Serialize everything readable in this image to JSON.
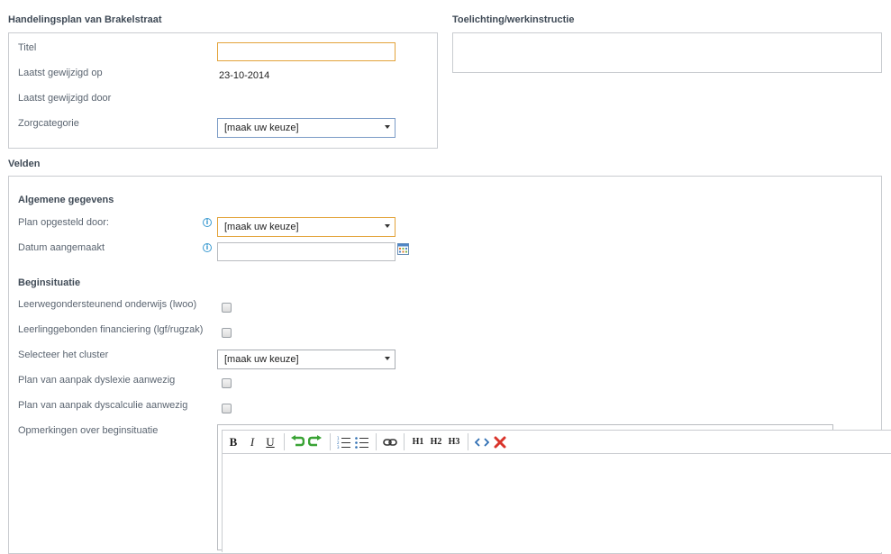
{
  "plan": {
    "title": "Handelingsplan van Brakelstraat",
    "fields": {
      "titel_label": "Titel",
      "titel_value": "",
      "gewijzigd_op_label": "Laatst gewijzigd op",
      "gewijzigd_op_value": "23-10-2014",
      "gewijzigd_door_label": "Laatst gewijzigd door",
      "gewijzigd_door_value": "",
      "zorgcategorie_label": "Zorgcategorie",
      "zorgcategorie_value": "[maak uw keuze]"
    }
  },
  "toelichting": {
    "title": "Toelichting/werkinstructie"
  },
  "velden": {
    "title": "Velden",
    "algemene": {
      "heading": "Algemene gegevens",
      "opgesteld_label": "Plan opgesteld door:",
      "opgesteld_value": "[maak uw keuze]",
      "datum_label": "Datum aangemaakt",
      "datum_value": ""
    },
    "begin": {
      "heading": "Beginsituatie",
      "lwoo_label": "Leerwegondersteunend onderwijs (lwoo)",
      "lgf_label": "Leerlinggebonden financiering (lgf/rugzak)",
      "cluster_label": "Selecteer het cluster",
      "cluster_value": "[maak uw keuze]",
      "dyslexie_label": "Plan van aanpak dyslexie aanwezig",
      "dyscalculie_label": "Plan van aanpak dyscalculie aanwezig",
      "opmerkingen_label": "Opmerkingen over beginsituatie"
    }
  },
  "editor_toolbar": {
    "bold": "B",
    "italic": "I",
    "underline": "U",
    "h1": "H1",
    "h2": "H2",
    "h3": "H3"
  },
  "colors": {
    "focus_orange": "#e3a33a",
    "select_blue": "#7b9bc6",
    "info_blue": "#3a9ad1",
    "undo_green": "#3aa335",
    "remove_red": "#d9342b"
  },
  "icons": [
    "info-icon",
    "calendar-icon",
    "undo-icon",
    "redo-icon",
    "ordered-list-icon",
    "unordered-list-icon",
    "link-icon",
    "source-code-icon",
    "remove-format-icon"
  ]
}
